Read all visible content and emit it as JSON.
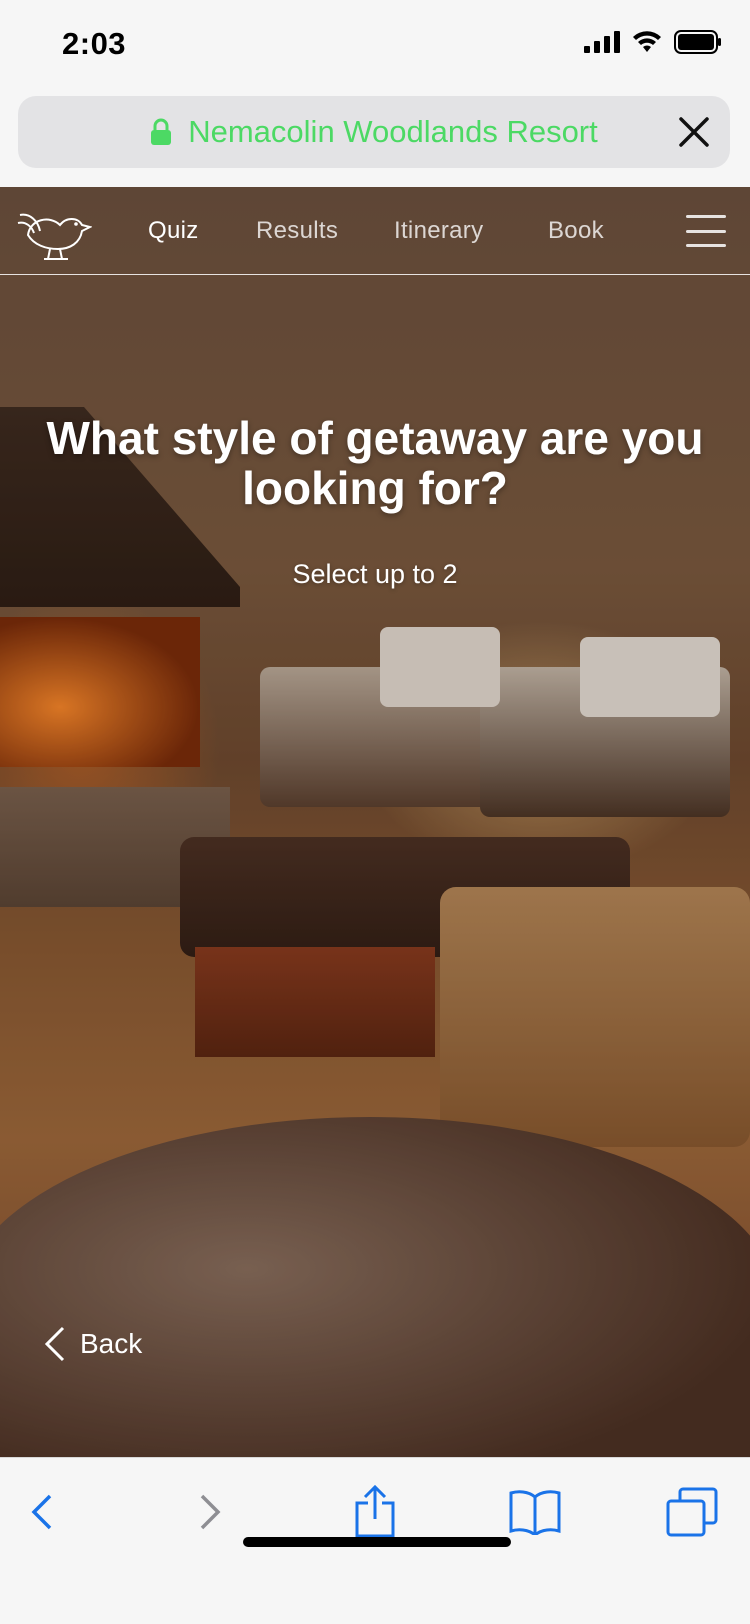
{
  "status_bar": {
    "time": "2:03",
    "icons": [
      "cellular-signal-icon",
      "wifi-icon",
      "battery-icon"
    ]
  },
  "browser": {
    "url_text": "Nemacolin Woodlands Resort",
    "secure_icon": "lock-icon",
    "close_icon": "close-icon",
    "url_color": "#4cd964"
  },
  "nav": {
    "logo_icon": "bird-logo-icon",
    "items": [
      {
        "label": "Quiz",
        "active": true
      },
      {
        "label": "Results",
        "active": false
      },
      {
        "label": "Itinerary",
        "active": false
      },
      {
        "label": "Book",
        "active": false
      }
    ],
    "menu_icon": "hamburger-menu-icon"
  },
  "quiz": {
    "question": "What style of getaway are you looking for?",
    "instruction": "Select up to 2",
    "back_label": "Back",
    "back_icon": "chevron-left-icon"
  },
  "toolbar": {
    "icons": [
      "back-arrow-icon",
      "forward-arrow-icon",
      "share-icon",
      "bookmarks-icon",
      "tabs-icon"
    ],
    "accent_color": "#1a73e8"
  }
}
